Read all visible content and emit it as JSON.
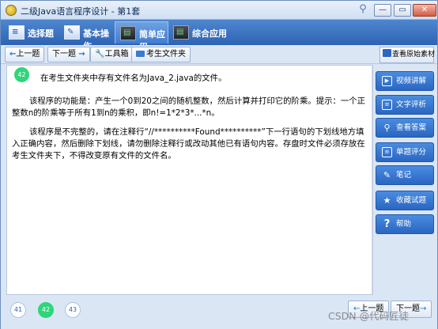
{
  "window": {
    "title": "二级Java语言程序设计 - 第1套",
    "minimize_glyph": "—",
    "maximize_glyph": "▭",
    "close_glyph": "✕",
    "pin_glyph": "⚲"
  },
  "tabs": [
    {
      "label": "选择题",
      "icon": "list-icon",
      "glyph": "≡",
      "active": false
    },
    {
      "label": "基本操作",
      "icon": "edit-icon",
      "glyph": "✎",
      "active": false
    },
    {
      "label": "简单应用",
      "icon": "terminal-icon",
      "glyph": "▤",
      "active": true
    },
    {
      "label": "综合应用",
      "icon": "terminal-icon",
      "glyph": "▤",
      "active": false
    }
  ],
  "toolbar": {
    "prev_label": "上一题",
    "next_label": "下一题",
    "tools_label": "工具箱",
    "folder_label": "考生文件夹",
    "view_source_label": "查看原始素材"
  },
  "question": {
    "number": "42",
    "paragraph1": "在考生文件夹中存有文件名为Java_2.java的文件。",
    "paragraph2": "该程序的功能是：产生一个0到20之间的随机整数，然后计算并打印它的阶乘。提示：一个正整数n的阶乘等于所有1到n的乘积，即n!=1*2*3*...*n。",
    "paragraph3": "该程序是不完整的，请在注释行“//**********Found**********”下一行语句的下划线地方填入正确内容，然后删除下划线，请勿删除注释行或改动其他已有语句内容。存盘时文件必须存放在考生文件夹下，不得改变原有文件的文件名。"
  },
  "sidebar": [
    {
      "label": "视频讲解",
      "icon": "video-icon",
      "glyph": "▶"
    },
    {
      "label": "文字评析",
      "icon": "text-analysis-icon",
      "glyph": "≡"
    },
    {
      "label": "查看答案",
      "icon": "search-icon",
      "glyph": "⚲"
    },
    {
      "label": "单题评分",
      "icon": "score-icon",
      "glyph": "≡"
    },
    {
      "label": "笔记",
      "icon": "note-icon",
      "glyph": "✎"
    },
    {
      "label": "收藏试题",
      "icon": "star-icon",
      "glyph": "★"
    },
    {
      "label": "帮助",
      "icon": "help-icon",
      "glyph": "?"
    }
  ],
  "bottom_nav": {
    "numbers": [
      "41",
      "42",
      "43"
    ],
    "current": "42",
    "prev_label": "上一题",
    "next_label": "下一题"
  },
  "watermark": "CSDN @代码匠徒",
  "colors": {
    "accent": "#2d63b3",
    "current_badge": "#2fd57a",
    "sidebar_button": "#2a66c2"
  }
}
